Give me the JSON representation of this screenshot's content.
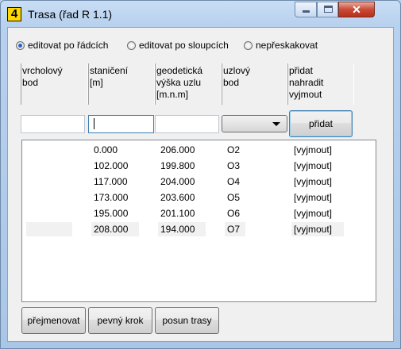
{
  "window": {
    "title": "Trasa (řad R 1.1)",
    "app_icon": "4"
  },
  "mode_options": [
    {
      "label": "editovat po řádcích",
      "selected": true
    },
    {
      "label": "editovat po sloupcích",
      "selected": false
    },
    {
      "label": "nepřeskakovat",
      "selected": false
    }
  ],
  "columns": [
    {
      "header": "vrcholový\nbod"
    },
    {
      "header": "staničení\n[m]"
    },
    {
      "header": "geodetická\nvýška uzlu\n[m.n.m]"
    },
    {
      "header": "uzlový\nbod"
    },
    {
      "header": "přidat\nnahradit\nvyjmout"
    }
  ],
  "inputs": {
    "vrcholovy_bod": "",
    "staniceni": "",
    "vyska": "",
    "uzlovy_bod_selected": ""
  },
  "add_button": "přidat",
  "rows": [
    {
      "bod": "",
      "staniceni": "0.000",
      "vyska": "206.000",
      "uzel": "O2",
      "akce": "[vyjmout]"
    },
    {
      "bod": "",
      "staniceni": "102.000",
      "vyska": "199.800",
      "uzel": "O3",
      "akce": "[vyjmout]"
    },
    {
      "bod": "",
      "staniceni": "117.000",
      "vyska": "204.000",
      "uzel": "O4",
      "akce": "[vyjmout]"
    },
    {
      "bod": "",
      "staniceni": "173.000",
      "vyska": "203.600",
      "uzel": "O5",
      "akce": "[vyjmout]"
    },
    {
      "bod": "",
      "staniceni": "195.000",
      "vyska": "201.100",
      "uzel": "O6",
      "akce": "[vyjmout]"
    },
    {
      "bod": "",
      "staniceni": "208.000",
      "vyska": "194.000",
      "uzel": "O7",
      "akce": "[vyjmout]"
    }
  ],
  "bottom_buttons": [
    "přejmenovat",
    "pevný krok",
    "posun trasy"
  ],
  "colors": {
    "accent": "#3c7fb1",
    "icon_bg": "#ffd800",
    "close": "#c94a35"
  }
}
